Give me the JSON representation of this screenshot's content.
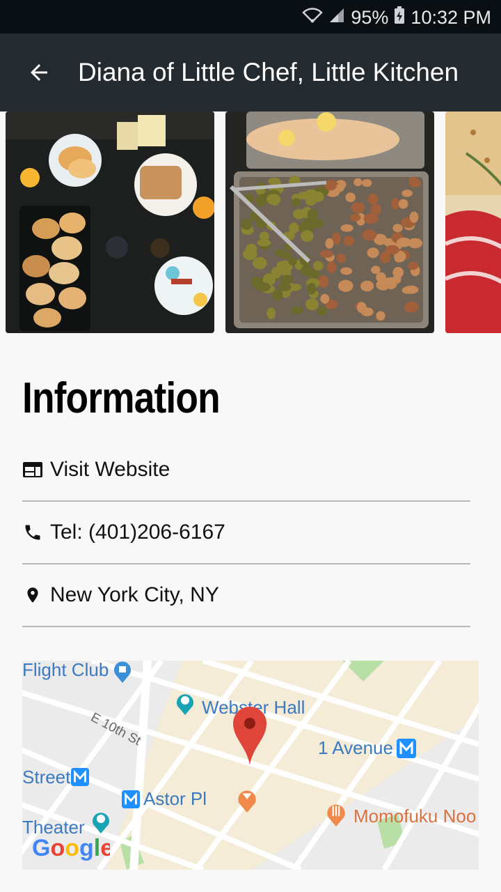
{
  "status_bar": {
    "battery": "95%",
    "time": "10:32 PM"
  },
  "app_bar": {
    "title": "Diana of Little Chef, Little Kitchen",
    "back_icon": "arrow-back-icon"
  },
  "gallery": {
    "photos": [
      "breakfast-table-photo",
      "sheet-pan-vegetables-photo",
      "focaccia-bread-photo"
    ]
  },
  "info": {
    "heading": "Information",
    "rows": [
      {
        "icon": "web-icon",
        "label": "Visit Website"
      },
      {
        "icon": "phone-icon",
        "label": "Tel: (401)206-6167"
      },
      {
        "icon": "location-pin-icon",
        "label": "New York City, NY"
      }
    ]
  },
  "map": {
    "labels": {
      "flight_club": "Flight Club",
      "webster_hall": "Webster Hall",
      "e10th": "E 10th St",
      "first_ave": "1 Avenue",
      "street": "Street",
      "astor": "Astor Pl",
      "momofuku": "Momofuku Noo",
      "theater": "Theater"
    },
    "logo": "Google",
    "colors": {
      "pin": "#e0453a",
      "transit": "#1e90ff",
      "restaurant": "#f08a4b"
    }
  }
}
